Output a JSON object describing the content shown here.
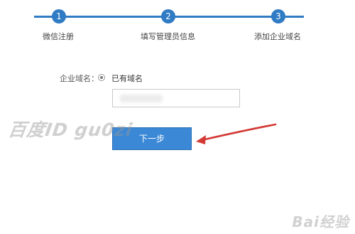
{
  "steps": [
    {
      "number": "1",
      "label": "微信注册"
    },
    {
      "number": "2",
      "label": "填写管理员信息"
    },
    {
      "number": "3",
      "label": "添加企业域名"
    }
  ],
  "form": {
    "domain_label": "企业域名：",
    "radio_option": "已有域名",
    "input_value": ""
  },
  "next_button": "下一步",
  "watermark": "百度ID gu0zi",
  "baidu_watermark": "Bai经验",
  "colors": {
    "step_blue": "#2f7bc4",
    "button_blue": "#3a88d6",
    "arrow_red": "#d33a35"
  }
}
